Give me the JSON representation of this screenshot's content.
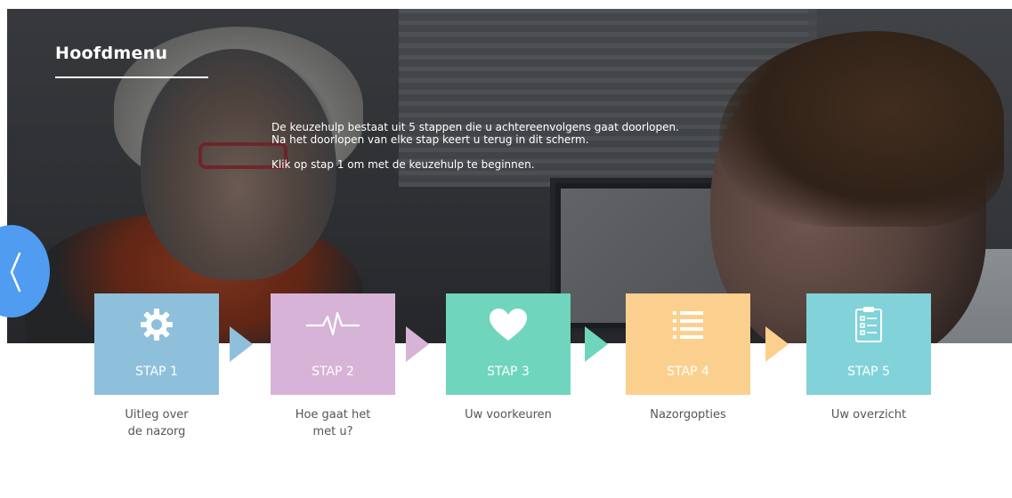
{
  "header": {
    "title": "Hoofdmenu"
  },
  "intro": {
    "line1": "De keuzehulp bestaat uit 5 stappen die u achtereenvolgens gaat doorlopen.",
    "line2": "Na het doorlopen van elke stap keert u terug in dit scherm.",
    "line3": "Klik op stap 1 om met de keuzehulp te beginnen."
  },
  "nav": {
    "back_icon": "chevron-left-icon"
  },
  "steps": [
    {
      "label": "STAP 1",
      "icon": "gear-icon",
      "color": "#8ec0dc",
      "caption_line1": "Uitleg over",
      "caption_line2": "de nazorg"
    },
    {
      "label": "STAP 2",
      "icon": "heartbeat-icon",
      "color": "#d7b3d7",
      "caption_line1": "Hoe gaat het",
      "caption_line2": "met u?"
    },
    {
      "label": "STAP 3",
      "icon": "heart-icon",
      "color": "#6fd6bd",
      "caption_line1": "Uw voorkeuren",
      "caption_line2": ""
    },
    {
      "label": "STAP 4",
      "icon": "list-icon",
      "color": "#fbd08e",
      "caption_line1": "Nazorgopties",
      "caption_line2": ""
    },
    {
      "label": "STAP 5",
      "icon": "checklist-icon",
      "color": "#82d3d9",
      "caption_line1": "Uw overzicht",
      "caption_line2": ""
    }
  ]
}
